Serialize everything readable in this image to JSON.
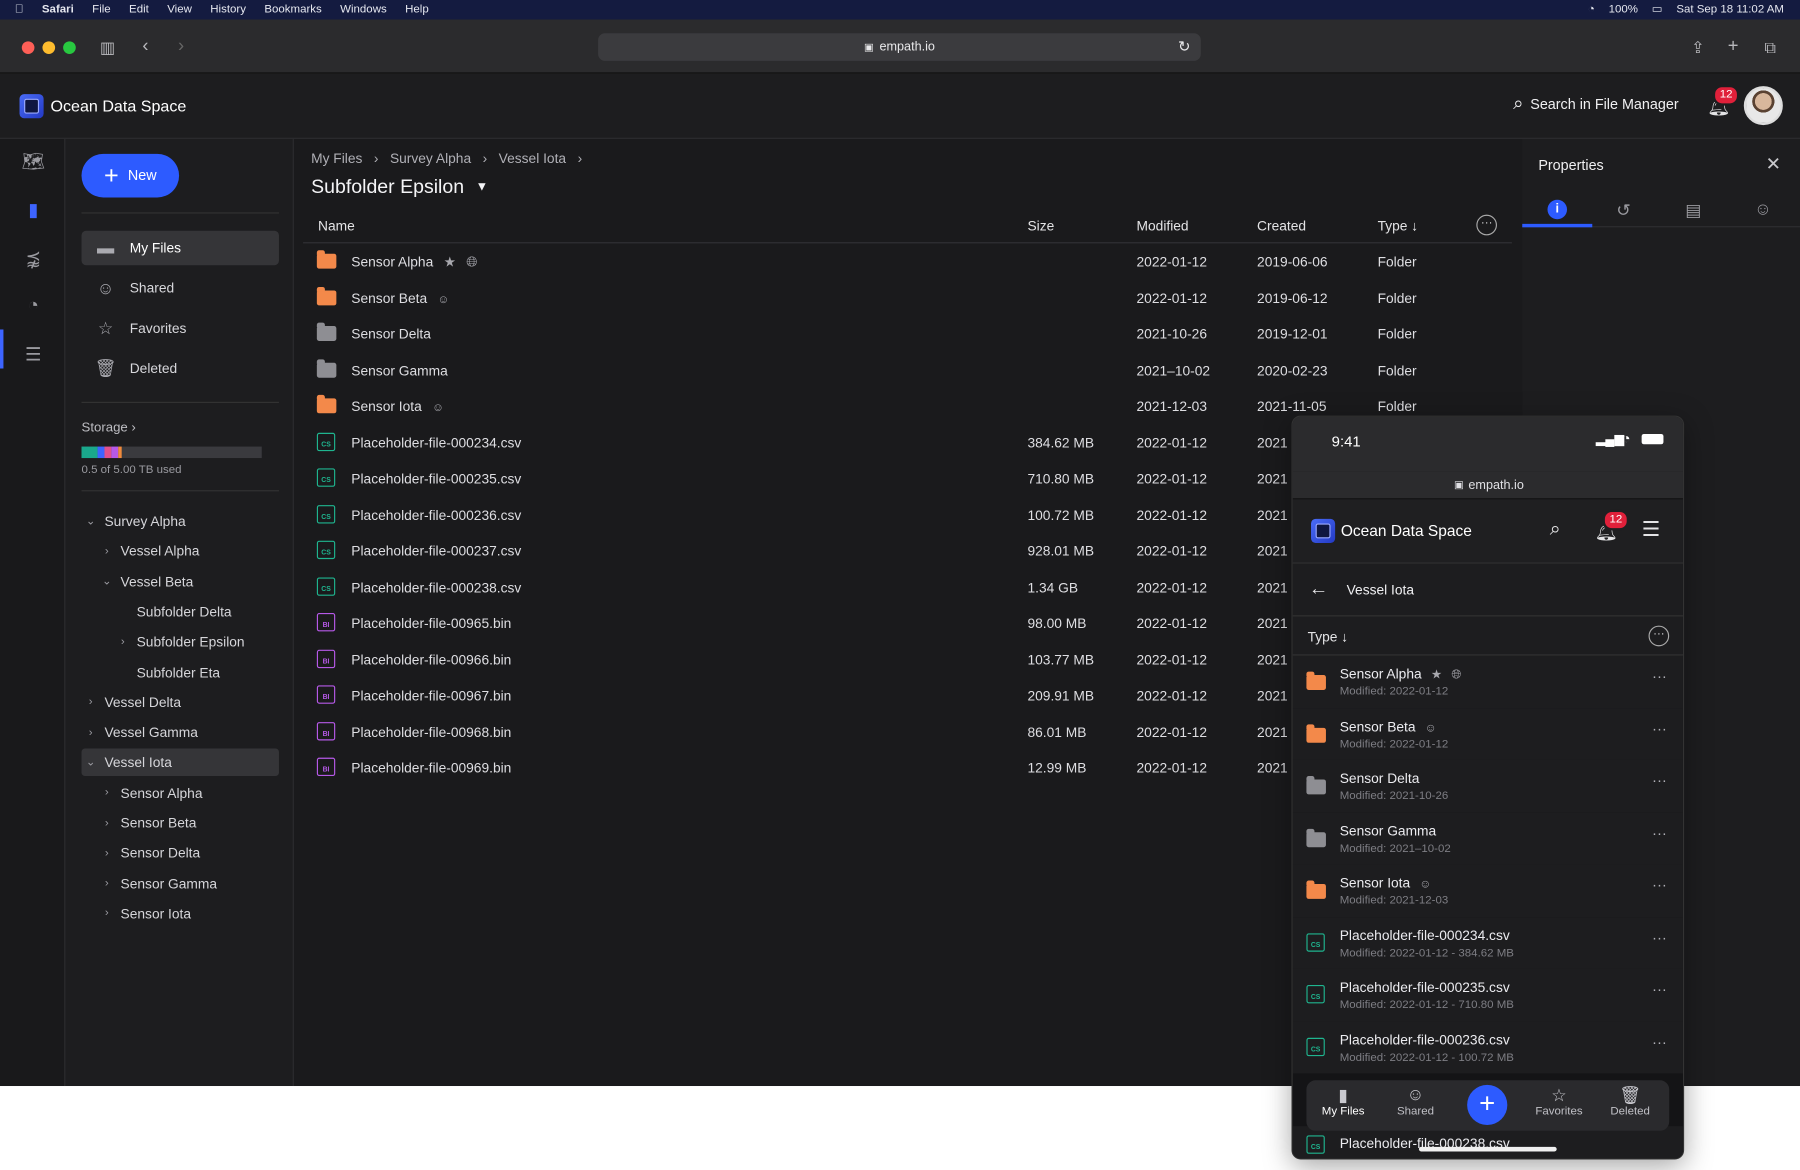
{
  "menubar": {
    "items": [
      "Safari",
      "File",
      "Edit",
      "View",
      "History",
      "Bookmarks",
      "Windows",
      "Help"
    ],
    "battery": "100%",
    "datetime": "Sat Sep 18 11:02 AM"
  },
  "browser": {
    "url": "empath.io"
  },
  "app": {
    "brand": "Ocean Data Space",
    "search_label": "Search in File Manager",
    "notifications": "12"
  },
  "sidebar": {
    "new_label": "New",
    "nav": [
      {
        "label": "My Files",
        "icon": "folder-icon"
      },
      {
        "label": "Shared",
        "icon": "shared-users-icon"
      },
      {
        "label": "Favorites",
        "icon": "star-icon"
      },
      {
        "label": "Deleted",
        "icon": "trash-icon"
      }
    ],
    "storage_label": "Storage",
    "storage_used": "0.5 of 5.00 TB used",
    "tree": [
      {
        "label": "Survey Alpha",
        "depth": 0,
        "chev": "down"
      },
      {
        "label": "Vessel Alpha",
        "depth": 1,
        "chev": "right"
      },
      {
        "label": "Vessel Beta",
        "depth": 1,
        "chev": "down"
      },
      {
        "label": "Subfolder Delta",
        "depth": 2,
        "chev": ""
      },
      {
        "label": "Subfolder Epsilon",
        "depth": 2,
        "chev": "right"
      },
      {
        "label": "Subfolder Eta",
        "depth": 2,
        "chev": ""
      },
      {
        "label": "Vessel Delta",
        "depth": 0,
        "chev": "right"
      },
      {
        "label": "Vessel Gamma",
        "depth": 0,
        "chev": "right"
      },
      {
        "label": "Vessel Iota",
        "depth": 0,
        "chev": "down",
        "selected": true
      },
      {
        "label": "Sensor Alpha",
        "depth": 1,
        "chev": "right"
      },
      {
        "label": "Sensor Beta",
        "depth": 1,
        "chev": "right"
      },
      {
        "label": "Sensor Delta",
        "depth": 1,
        "chev": "right"
      },
      {
        "label": "Sensor Gamma",
        "depth": 1,
        "chev": "right"
      },
      {
        "label": "Sensor Iota",
        "depth": 1,
        "chev": "right"
      }
    ]
  },
  "main": {
    "breadcrumb": [
      "My Files",
      "Survey Alpha",
      "Vessel Iota"
    ],
    "folder_title": "Subfolder Epsilon",
    "columns": {
      "name": "Name",
      "size": "Size",
      "modified": "Modified",
      "created": "Created",
      "type": "Type"
    },
    "rows": [
      {
        "name": "Sensor Alpha",
        "size": "",
        "modified": "2022-01-12",
        "created": "2019-06-06",
        "type": "Folder",
        "kind": "folder-orange",
        "flags": [
          "star",
          "globe"
        ]
      },
      {
        "name": "Sensor Beta",
        "size": "",
        "modified": "2022-01-12",
        "created": "2019-06-12",
        "type": "Folder",
        "kind": "folder-orange",
        "flags": [
          "shared"
        ]
      },
      {
        "name": "Sensor Delta",
        "size": "",
        "modified": "2021-10-26",
        "created": "2019-12-01",
        "type": "Folder",
        "kind": "folder-gray",
        "flags": []
      },
      {
        "name": "Sensor Gamma",
        "size": "",
        "modified": "2021–10-02",
        "created": "2020-02-23",
        "type": "Folder",
        "kind": "folder-gray",
        "flags": []
      },
      {
        "name": "Sensor Iota",
        "size": "",
        "modified": "2021-12-03",
        "created": "2021-11-05",
        "type": "Folder",
        "kind": "folder-orange",
        "flags": [
          "shared"
        ]
      },
      {
        "name": "Placeholder-file-000234.csv",
        "size": "384.62 MB",
        "modified": "2022-01-12",
        "created": "2021",
        "type": "",
        "kind": "csv",
        "flags": []
      },
      {
        "name": "Placeholder-file-000235.csv",
        "size": "710.80 MB",
        "modified": "2022-01-12",
        "created": "2021",
        "type": "",
        "kind": "csv",
        "flags": []
      },
      {
        "name": "Placeholder-file-000236.csv",
        "size": "100.72 MB",
        "modified": "2022-01-12",
        "created": "2021",
        "type": "",
        "kind": "csv",
        "flags": []
      },
      {
        "name": "Placeholder-file-000237.csv",
        "size": "928.01 MB",
        "modified": "2022-01-12",
        "created": "2021",
        "type": "",
        "kind": "csv",
        "flags": []
      },
      {
        "name": "Placeholder-file-000238.csv",
        "size": "1.34 GB",
        "modified": "2022-01-12",
        "created": "2021",
        "type": "",
        "kind": "csv",
        "flags": []
      },
      {
        "name": "Placeholder-file-00965.bin",
        "size": "98.00 MB",
        "modified": "2022-01-12",
        "created": "2021",
        "type": "",
        "kind": "bin",
        "flags": []
      },
      {
        "name": "Placeholder-file-00966.bin",
        "size": "103.77 MB",
        "modified": "2022-01-12",
        "created": "2021",
        "type": "",
        "kind": "bin",
        "flags": []
      },
      {
        "name": "Placeholder-file-00967.bin",
        "size": "209.91 MB",
        "modified": "2022-01-12",
        "created": "2021",
        "type": "",
        "kind": "bin",
        "flags": []
      },
      {
        "name": "Placeholder-file-00968.bin",
        "size": "86.01 MB",
        "modified": "2022-01-12",
        "created": "2021",
        "type": "",
        "kind": "bin",
        "flags": []
      },
      {
        "name": "Placeholder-file-00969.bin",
        "size": "12.99 MB",
        "modified": "2022-01-12",
        "created": "2021",
        "type": "",
        "kind": "bin",
        "flags": []
      }
    ]
  },
  "properties": {
    "title": "Properties",
    "tabs": [
      "info-icon",
      "history-icon",
      "comments-icon",
      "people-icon"
    ]
  },
  "phone": {
    "time": "9:41",
    "url": "empath.io",
    "brand": "Ocean Data Space",
    "notifications": "12",
    "back_title": "Vessel Iota",
    "sort_label": "Type",
    "rows": [
      {
        "name": "Sensor Alpha",
        "meta": "Modified: 2022-01-12",
        "kind": "folder-orange",
        "flags": [
          "star",
          "globe"
        ]
      },
      {
        "name": "Sensor Beta",
        "meta": "Modified: 2022-01-12",
        "kind": "folder-orange",
        "flags": [
          "shared"
        ]
      },
      {
        "name": "Sensor Delta",
        "meta": "Modified: 2021-10-26",
        "kind": "folder-gray",
        "flags": []
      },
      {
        "name": "Sensor Gamma",
        "meta": "Modified: 2021–10-02",
        "kind": "folder-gray",
        "flags": []
      },
      {
        "name": "Sensor Iota",
        "meta": "Modified: 2021-12-03",
        "kind": "folder-orange",
        "flags": [
          "shared"
        ]
      },
      {
        "name": "Placeholder-file-000234.csv",
        "meta": "Modified: 2022-01-12 - 384.62 MB",
        "kind": "csv",
        "flags": []
      },
      {
        "name": "Placeholder-file-000235.csv",
        "meta": "Modified: 2022-01-12 - 710.80 MB",
        "kind": "csv",
        "flags": []
      },
      {
        "name": "Placeholder-file-000236.csv",
        "meta": "Modified: 2022-01-12 - 100.72 MB",
        "kind": "csv",
        "flags": []
      }
    ],
    "partial_row": "Placeholder-file-000238.csv",
    "tabbar": [
      {
        "label": "My Files",
        "icon": "file-icon"
      },
      {
        "label": "Shared",
        "icon": "shared-users-icon"
      },
      {
        "label": "Favorites",
        "icon": "star-icon"
      },
      {
        "label": "Deleted",
        "icon": "trash-icon"
      }
    ]
  },
  "colors": {
    "accent": "#2d5bff",
    "folder_orange": "#f3894a",
    "folder_gray": "#8e8e93",
    "csv": "#1fb58f",
    "bin": "#b659e8",
    "badge": "#e0203a"
  }
}
